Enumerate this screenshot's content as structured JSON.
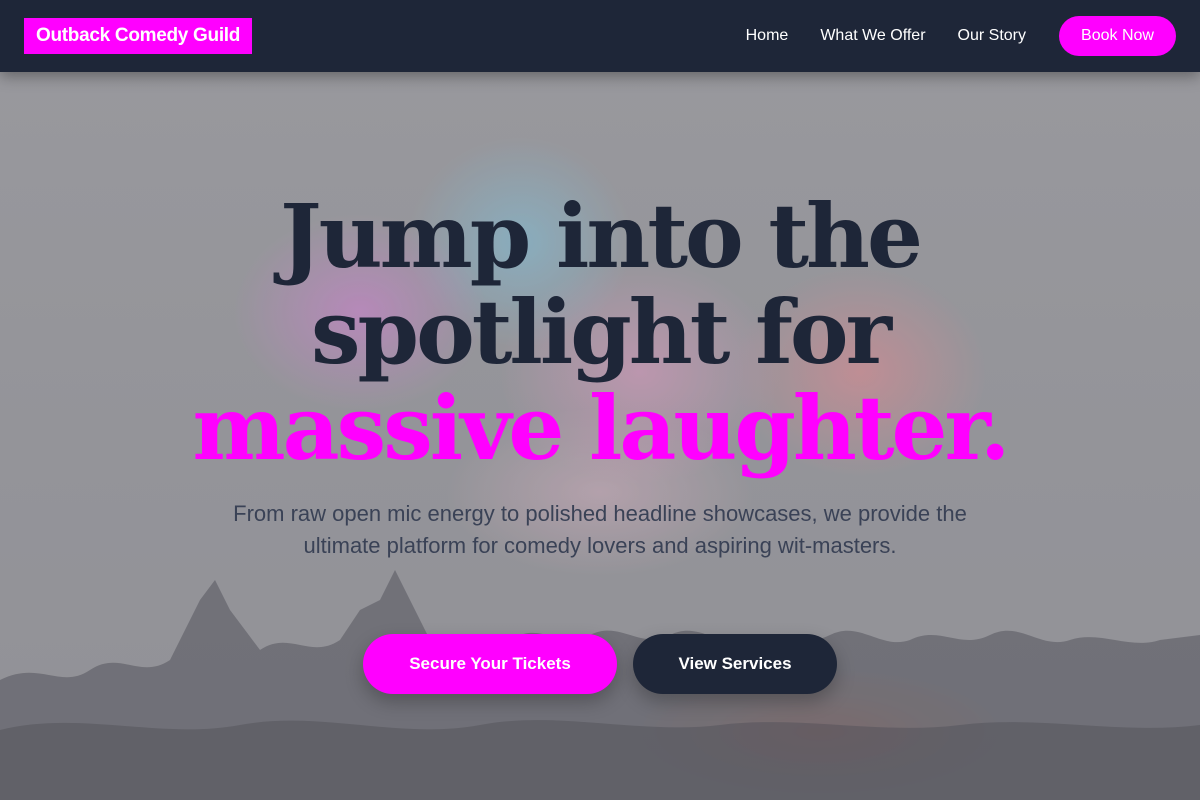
{
  "header": {
    "brand": "Outback Comedy Guild",
    "nav": [
      {
        "label": "Home"
      },
      {
        "label": "What We Offer"
      },
      {
        "label": "Our Story"
      }
    ],
    "cta_label": "Book Now"
  },
  "hero": {
    "headline_line1": "Jump into the",
    "headline_line2": "spotlight for",
    "headline_accent": "massive laughter.",
    "subtitle": "From raw open mic energy to polished headline showcases, we provide the ultimate platform for comedy lovers and aspiring wit-masters.",
    "primary_cta": "Secure Your Tickets",
    "secondary_cta": "View Services",
    "background_image": "fireworks-over-crowd"
  },
  "colors": {
    "brand": "#ff00ff",
    "dark": "#1e2638",
    "text_muted": "#3a4256",
    "white": "#ffffff"
  }
}
